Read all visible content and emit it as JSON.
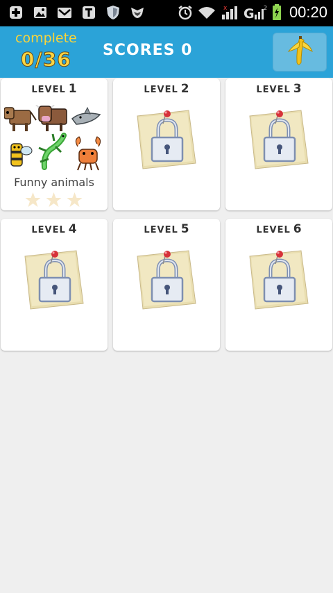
{
  "status_bar": {
    "left_icons": [
      "add-icon",
      "image-icon",
      "mail-icon",
      "t-icon",
      "shield-icon",
      "fox-icon"
    ],
    "right_icons": [
      "alarm-icon",
      "wifi-icon",
      "signal-icon",
      "g-signal-icon",
      "battery-icon"
    ],
    "time": "00:20"
  },
  "header": {
    "complete_label": "complete",
    "complete_value": "0/36",
    "scores_text": "SCORES 0",
    "button_icon": "banana-icon"
  },
  "levels": [
    {
      "word": "LEVEL",
      "number": "1",
      "name": "Funny animals",
      "locked": false,
      "stars_earned": 0,
      "stars_total": 3
    },
    {
      "word": "LEVEL",
      "number": "2",
      "locked": true
    },
    {
      "word": "LEVEL",
      "number": "3",
      "locked": true
    },
    {
      "word": "LEVEL",
      "number": "4",
      "locked": true
    },
    {
      "word": "LEVEL",
      "number": "5",
      "locked": true
    },
    {
      "word": "LEVEL",
      "number": "6",
      "locked": true
    }
  ],
  "colors": {
    "header_bg": "#2ba3d8",
    "accent_yellow": "#fad43a",
    "page_bg": "#efefef"
  }
}
